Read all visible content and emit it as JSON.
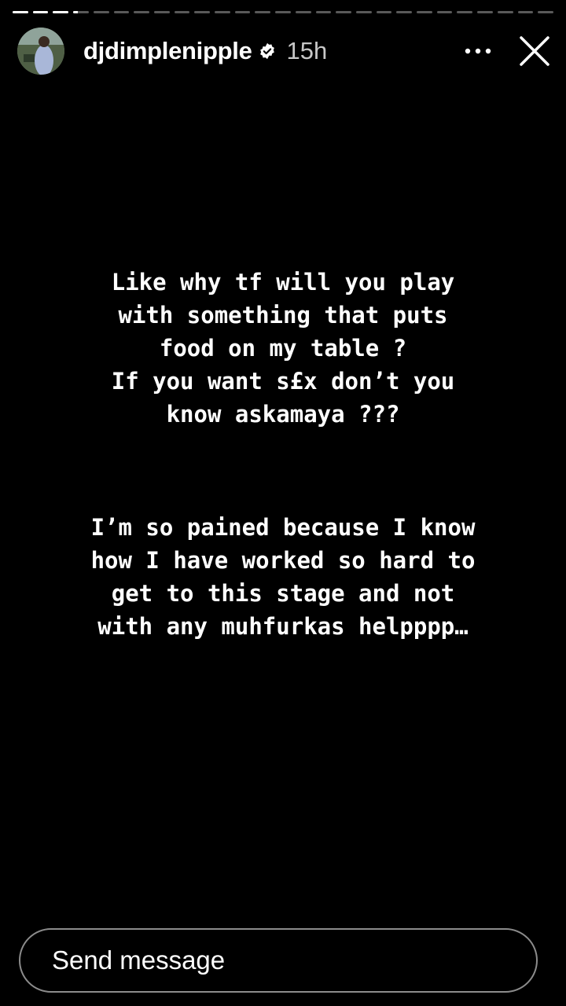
{
  "progress": {
    "segments": [
      1,
      1,
      1,
      0.3,
      0,
      0,
      0,
      0,
      0,
      0,
      0,
      0,
      0,
      0,
      0,
      0,
      0,
      0,
      0,
      0,
      0,
      0,
      0,
      0,
      0,
      0,
      0
    ]
  },
  "header": {
    "username": "djdimplenipple",
    "verified": true,
    "time": "15h",
    "more_icon": "more-horizontal-icon",
    "close_icon": "close-icon"
  },
  "story": {
    "paragraph1": "Like why tf will you play\nwith something that puts\nfood on my table ?\nIf you want s£x don’t you\nknow askamaya ???",
    "paragraph2": "I’m so pained because I know\nhow I have worked so hard to\nget to this stage and not\nwith any muhfurkas helpppp…"
  },
  "composer": {
    "placeholder": "Send message"
  }
}
